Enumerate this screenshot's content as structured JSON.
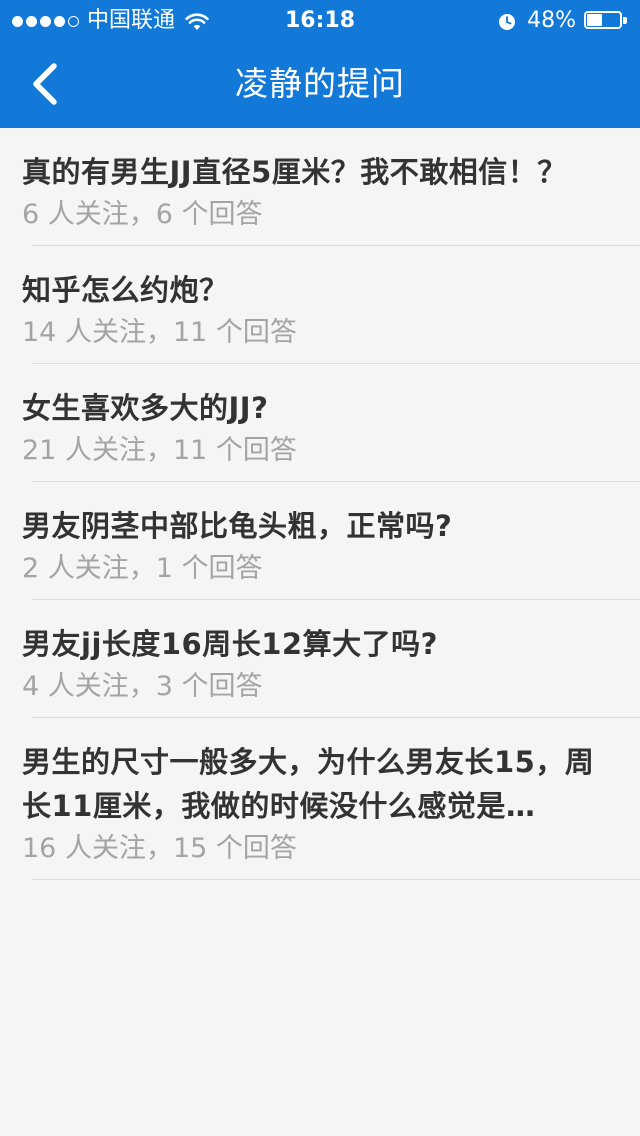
{
  "status_bar": {
    "carrier": "中国联通",
    "time": "16:18",
    "battery_percent": "48%",
    "battery_level": 0.48,
    "signal_bars_filled": 4,
    "signal_bars_total": 5
  },
  "nav": {
    "title": "凌静的提问",
    "back_icon": "chevron-left-icon"
  },
  "colors": {
    "header_bg": "#1279d9",
    "title_text": "#333333",
    "meta_text": "#a4a4a4",
    "page_bg": "#f5f5f5"
  },
  "questions": [
    {
      "title": "真的有男生JJ直径5厘米？我不敢相信！？",
      "meta": "6 人关注，6 个回答"
    },
    {
      "title": "知乎怎么约炮？",
      "meta": "14 人关注，11 个回答"
    },
    {
      "title": "女生喜欢多大的JJ?",
      "meta": "21 人关注，11 个回答"
    },
    {
      "title": "男友阴茎中部比龟头粗，正常吗?",
      "meta": "2 人关注，1 个回答"
    },
    {
      "title": "男友jj长度16周长12算大了吗?",
      "meta": "4 人关注，3 个回答"
    },
    {
      "title": "男生的尺寸一般多大，为什么男友长15，周长11厘米，我做的时候没什么感觉是…",
      "meta": "16 人关注，15 个回答"
    }
  ]
}
